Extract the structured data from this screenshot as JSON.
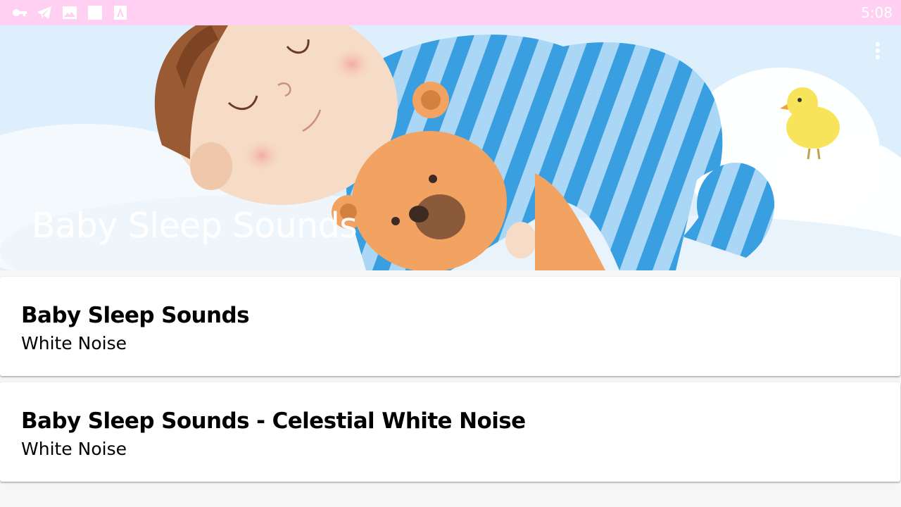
{
  "status_bar": {
    "time": "5:08",
    "icons": [
      "key-icon",
      "telegram-icon",
      "image-icon",
      "square-icon",
      "app-store-icon"
    ]
  },
  "header": {
    "title": "Baby Sleep Sounds",
    "image": "sleeping-baby-with-teddy-bear-illustration",
    "menu_icon": "more-vert-icon"
  },
  "list": {
    "items": [
      {
        "title": "Baby Sleep Sounds",
        "subtitle": "White Noise"
      },
      {
        "title": "Baby Sleep Sounds - Celestial White Noise",
        "subtitle": "White Noise"
      }
    ]
  },
  "colors": {
    "status_bar": "#ffd0f2",
    "header_sky": "#ddeffc",
    "stripe_blue": "#3a9fe0",
    "stripe_light": "#a9d7f5",
    "teddy": "#f2a362",
    "skin": "#f6dcc6"
  }
}
